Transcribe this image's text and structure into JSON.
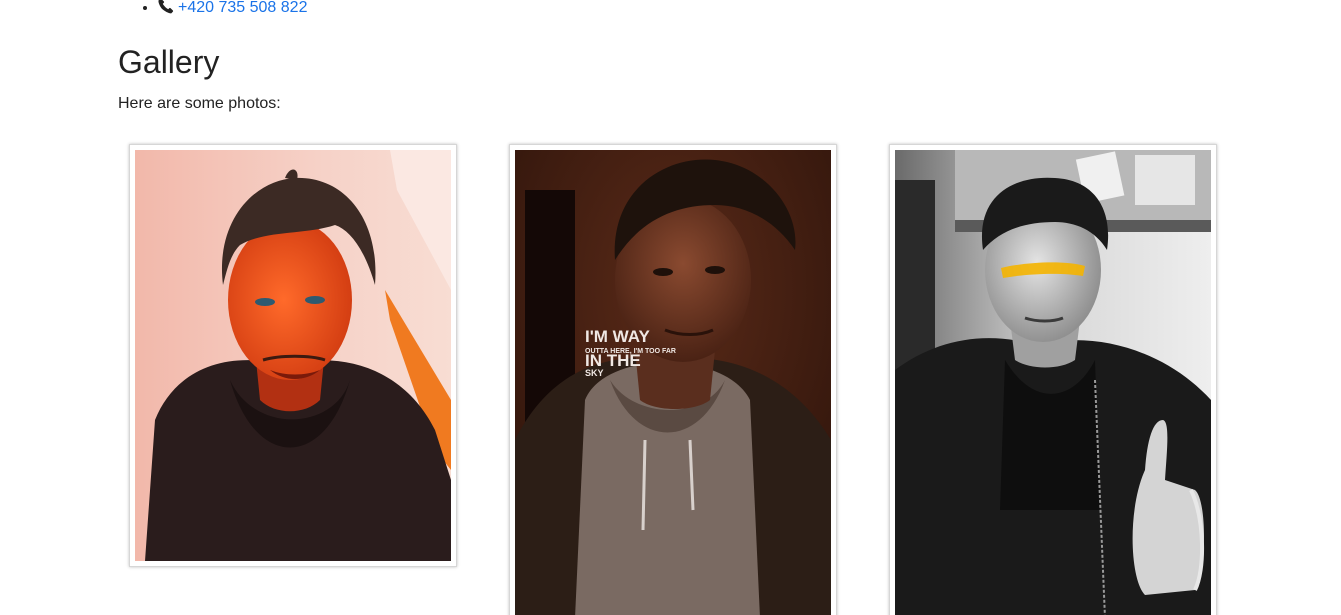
{
  "contact": {
    "phone_icon": "phone-icon",
    "phone": "+420 735 508 822"
  },
  "gallery": {
    "title": "Gallery",
    "description": "Here are some photos:",
    "photos": [
      {
        "icon": "portrait-photo",
        "palette": "warm-orange"
      },
      {
        "icon": "portrait-photo",
        "palette": "dark-brown",
        "overlay_lines": [
          "I'M WAY",
          "OUTTA HERE, I'M TOO FAR",
          "IN THE",
          "SKY"
        ]
      },
      {
        "icon": "portrait-photo",
        "palette": "grayscale",
        "accent": "#f4b400"
      }
    ]
  }
}
